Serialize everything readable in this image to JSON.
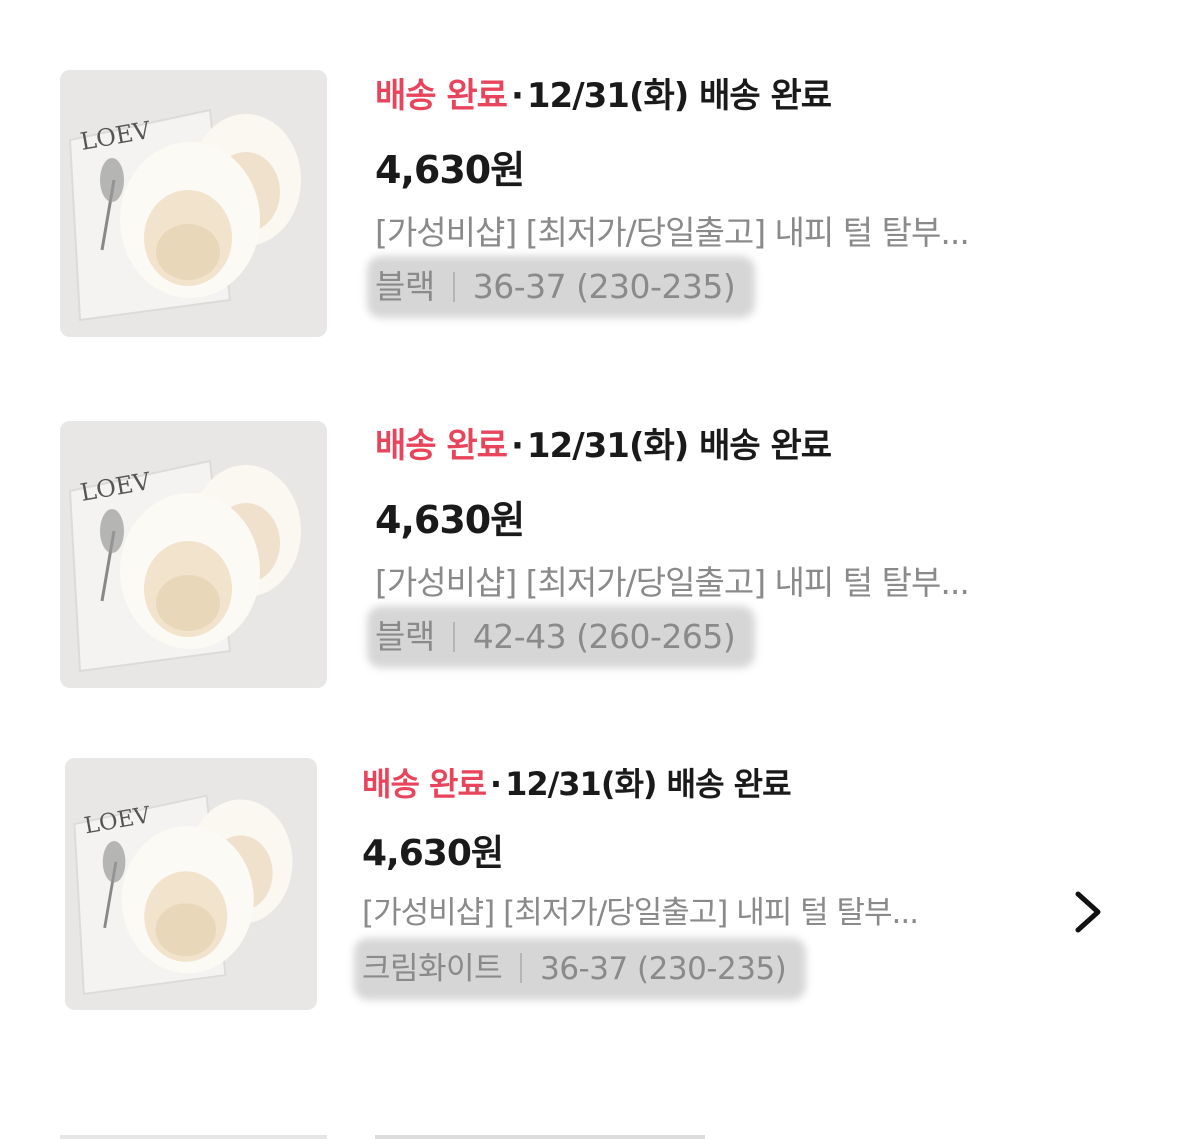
{
  "orders": [
    {
      "status": "배송 완료",
      "separator": "·",
      "delivery_date": "12/31(화) 배송 완료",
      "price": "4,630원",
      "title": "[가성비샵] [최저가/당일출고] 내피 털 탈부...",
      "color": "블랙",
      "size": "36-37 (230-235)",
      "thumbnail_text": "LOEV"
    },
    {
      "status": "배송 완료",
      "separator": "·",
      "delivery_date": "12/31(화) 배송 완료",
      "price": "4,630원",
      "title": "[가성비샵] [최저가/당일출고] 내피 털 탈부...",
      "color": "블랙",
      "size": "42-43 (260-265)",
      "thumbnail_text": "LOEV"
    },
    {
      "status": "배송 완료",
      "separator": "·",
      "delivery_date": "12/31(화) 배송 완료",
      "price": "4,630원",
      "title": "[가성비샵] [최저가/당일출고] 내피 털 탈부...",
      "color": "크림화이트",
      "size": "36-37 (230-235)",
      "thumbnail_text": "LOEV"
    }
  ],
  "icons": {
    "detail": "chevron-right-icon"
  },
  "colors": {
    "status": "#e8455c",
    "text": "#1a1a1a",
    "muted": "#8a8a8a"
  }
}
